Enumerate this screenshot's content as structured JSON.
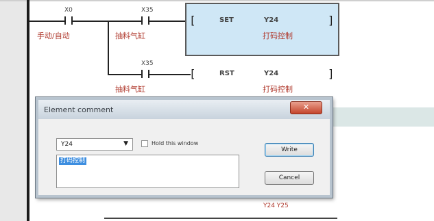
{
  "ladder": {
    "contact_x0": "X0",
    "contact_x0_comment": "手动/自动",
    "contact_x35_top": "X35",
    "contact_x35_top_comment": "抽料气缸",
    "contact_x35_bottom": "X35",
    "contact_x35_bottom_comment": "抽料气缸",
    "row1_instr": "SET",
    "row1_operand": "Y24",
    "row1_comment": "打码控制",
    "row2_instr": "RST",
    "row2_operand": "Y24",
    "row2_comment": "打码控制",
    "residual_text": "Y24 Y25"
  },
  "dialog": {
    "title": "Element comment",
    "close_label": "✕",
    "device_value": "Y24",
    "hold_label": "Hold this window",
    "comment_value": "打码控制",
    "write_label": "Write",
    "cancel_label": "Cancel"
  },
  "colors": {
    "comment_red": "#b03a2e",
    "selection_blue": "#cfe7f6",
    "text_selection": "#3d8ee0"
  }
}
